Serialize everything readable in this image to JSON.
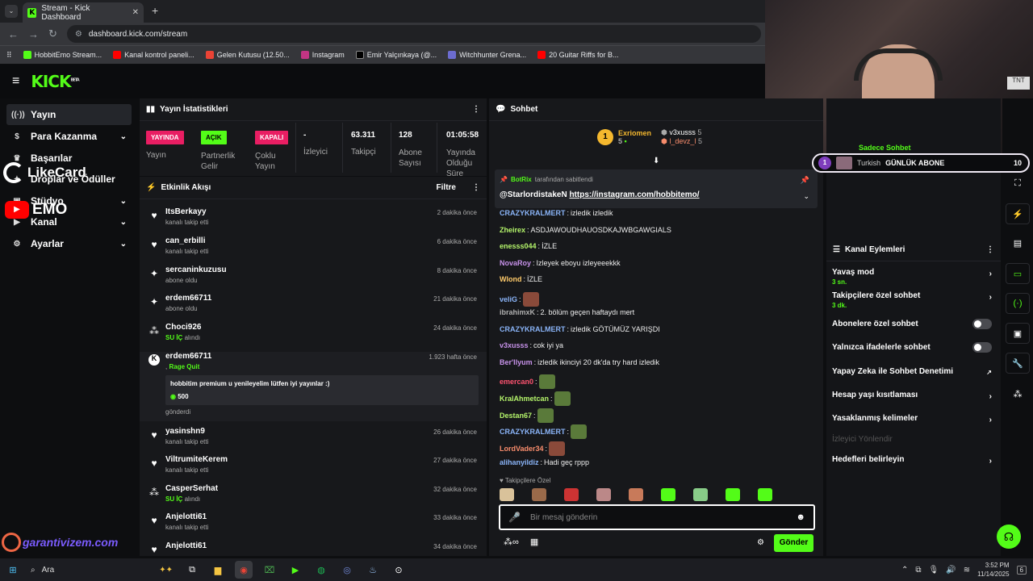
{
  "browser": {
    "tab_title": "Stream - Kick Dashboard",
    "url": "dashboard.kick.com/stream",
    "bookmarks": [
      "HobbitEmo Stream...",
      "Kanal kontrol paneli...",
      "Gelen Kutusu (12.50...",
      "Instagram",
      "Emir Yalçınkaya (@...",
      "Witchhunter Grena...",
      "20 Guitar Riffs for B..."
    ]
  },
  "header": {
    "logo": "KICK",
    "logo_sup": "BETA"
  },
  "sidebar": {
    "items": [
      {
        "label": "Yayın",
        "icon": "stream-icon"
      },
      {
        "label": "Para Kazanma",
        "icon": "money-icon"
      },
      {
        "label": "Başarılar",
        "icon": "trophy-icon"
      },
      {
        "label": "Droplar ve Ödüller",
        "icon": "gift-icon"
      },
      {
        "label": "Stüdyo",
        "icon": "studio-icon"
      },
      {
        "label": "Kanal",
        "icon": "channel-icon"
      },
      {
        "label": "Ayarlar",
        "icon": "gear-icon"
      }
    ]
  },
  "overlay": {
    "likecard": "LikeCard",
    "emo": "EMO",
    "garanti": "garantivizem.com"
  },
  "stats": {
    "title": "Yayın İstatistikleri",
    "stream_badge": "YAYINDA",
    "stream_label": "Yayın",
    "partner_badge": "AÇIK",
    "partner_label": "Partnerlik Gelir",
    "multi_badge": "KAPALI",
    "multi_label": "Çoklu Yayın",
    "viewers_value": "-",
    "viewers_label": "İzleyici",
    "followers_value": "63.311",
    "followers_label": "Takipçi",
    "subs_value": "128",
    "subs_label": "Abone Sayısı",
    "uptime_value": "01:05:58",
    "uptime_label": "Yayında Olduğu Süre"
  },
  "activity": {
    "title": "Etkinlik Akışı",
    "filter": "Filtre",
    "items": [
      {
        "user": "ItsBerkayy",
        "sub": "kanalı takip etti",
        "time": "2 dakika önce",
        "icon": "heart"
      },
      {
        "user": "can_erbilli",
        "sub": "kanalı takip etti",
        "time": "6 dakika önce",
        "icon": "heart"
      },
      {
        "user": "sercaninkuzusu",
        "sub": "abone oldu",
        "time": "8 dakika önce",
        "icon": "star"
      },
      {
        "user": "erdem66711",
        "sub": "abone oldu",
        "time": "21 dakika önce",
        "icon": "star"
      },
      {
        "user": "Choci926",
        "sub_green": "SU İÇ",
        "sub": "alındı",
        "time": "24 dakika önce",
        "icon": "points"
      },
      {
        "user": "erdem66711",
        "sub_green": "Rage Quit",
        "sub_prefix": ",",
        "time": "1.923 hafta önce",
        "icon": "kick"
      },
      {
        "user": "yasinshn9",
        "sub": "kanalı takip etti",
        "time": "26 dakika önce",
        "icon": "heart"
      },
      {
        "user": "ViltrumiteKerem",
        "sub": "kanalı takip etti",
        "time": "27 dakika önce",
        "icon": "heart"
      },
      {
        "user": "CasperSerhat",
        "sub_green": "SU İÇ",
        "sub": "alındı",
        "time": "32 dakika önce",
        "icon": "points"
      },
      {
        "user": "Anjelotti61",
        "sub": "kanalı takip etti",
        "time": "33 dakika önce",
        "icon": "heart"
      },
      {
        "user": "Anjelotti61",
        "sub": "",
        "time": "34 dakika önce",
        "icon": "heart"
      }
    ],
    "rage_message": "hobbitim premium u yenileyelim lütfen iyi yayınlar :)",
    "rage_amount": "500",
    "rage_sent": "gönderdi"
  },
  "chat": {
    "title": "Sohbet",
    "leader1": "Exriomen",
    "leader1_count": "5",
    "leader2": "v3xusss",
    "leader2_count": "5",
    "leader3": "l_devz_l",
    "leader3_count": "5",
    "rank": "1",
    "pin_by": "BotRix",
    "pin_text": "tarafından sabitlendi",
    "pin_user": "@StarlordistakeN",
    "pin_link": "https://instagram.com/hobbitemo/",
    "messages": [
      {
        "user": "CRAZYKRALMERT",
        "color": "#8ab4f8",
        "text": "izledik izledik"
      },
      {
        "user": "Zheirex",
        "color": "#b5f56b",
        "text": "ASDJAWOUDHAUOSDKAJWBGAWGIALS"
      },
      {
        "user": "enesss044",
        "color": "#b5f56b",
        "text": "İZLE"
      },
      {
        "user": "NovaRoy",
        "color": "#c792ea",
        "text": "Izleyek eboyu izleyeeekkk"
      },
      {
        "user": "Wlond",
        "color": "#ffcb6b",
        "text": "İZLE"
      },
      {
        "user": "veliG",
        "color": "#8ab4f8",
        "text": "",
        "emote": "#8a4a3a"
      },
      {
        "user": "ibrahimxK",
        "color": "#b0b0b0",
        "text": "2. bölüm geçen haftaydı mert"
      },
      {
        "user": "CRAZYKRALMERT",
        "color": "#8ab4f8",
        "text": "izledik GÖTÜMÜZ YARIŞDI"
      },
      {
        "user": "v3xusss",
        "color": "#c792ea",
        "text": "cok iyi ya"
      },
      {
        "user": "Ber'llyum",
        "color": "#c792ea",
        "text": "izledik ikinciyi 20 dk'da try hard izledik"
      },
      {
        "user": "emercan0",
        "color": "#ff5370",
        "text": "",
        "emote": "#5a7a3a"
      },
      {
        "user": "KralAhmetcan",
        "color": "#b5f56b",
        "text": "",
        "emote": "#5a7a3a"
      },
      {
        "user": "Destan67",
        "color": "#b5f56b",
        "text": "",
        "emote": "#5a7a3a"
      },
      {
        "user": "CRAZYKRALMERT",
        "color": "#8ab4f8",
        "text": "",
        "emote": "#5a7a3a"
      },
      {
        "user": "LordVader34",
        "color": "#f78c6c",
        "text": "",
        "emote": "#8a4a3a"
      },
      {
        "user": "alihanyildiz",
        "color": "#8ab4f8",
        "text": "Hadi geç rppp"
      }
    ],
    "followers_only": "Takipçilere Özel",
    "placeholder": "Bir mesaj gönderin",
    "send": "Gönder"
  },
  "subgoal": {
    "rank": "1",
    "lang": "Turkish",
    "goal": "GÜNLÜK ABONE",
    "count": "10",
    "top_text": "Sadece Sohbet"
  },
  "channel_actions": {
    "title": "Kanal Eylemleri",
    "slow": "Yavaş mod",
    "slow_val": "3 sn.",
    "followers": "Takipçilere özel sohbet",
    "followers_val": "3 dk.",
    "subs_only": "Abonelere özel sohbet",
    "emotes_only": "Yalnızca ifadelerle sohbet",
    "ai": "Yapay Zeka ile Sohbet Denetimi",
    "age": "Hesap yaşı kısıtlaması",
    "banned": "Yasaklanmış kelimeler",
    "redirect": "İzleyici Yönlendir",
    "goals": "Hedefleri belirleyin"
  },
  "taskbar": {
    "search": "Ara",
    "time": "3:52 PM",
    "date": "11/14/2025",
    "notif": "6"
  },
  "colors": {
    "accent": "#53fc18",
    "live": "#e91e63"
  }
}
